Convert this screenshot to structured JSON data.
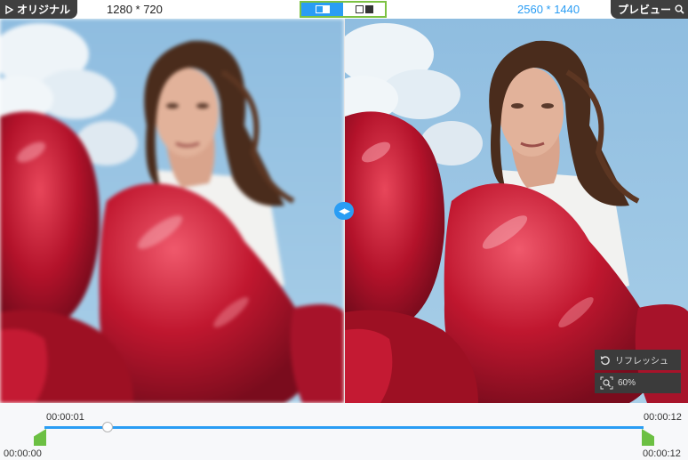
{
  "toolbar": {
    "original_label": "オリジナル",
    "original_resolution": "1280 * 720",
    "preview_resolution": "2560 * 1440",
    "preview_label": "プレビュー",
    "modes": [
      "split-view",
      "side-by-side"
    ],
    "active_mode": "split-view"
  },
  "overlay": {
    "refresh_label": "リフレッシュ",
    "zoom_label": "60%"
  },
  "timeline": {
    "current_time": "00:00:01",
    "start_time": "00:00:00",
    "end_time_top": "00:00:12",
    "end_time_bottom": "00:00:12",
    "progress": 0.1
  },
  "colors": {
    "accent": "#2a9df4",
    "toggle_border": "#7cc242",
    "trim_handle": "#6cc043",
    "dark_button": "#3f3f3f"
  }
}
